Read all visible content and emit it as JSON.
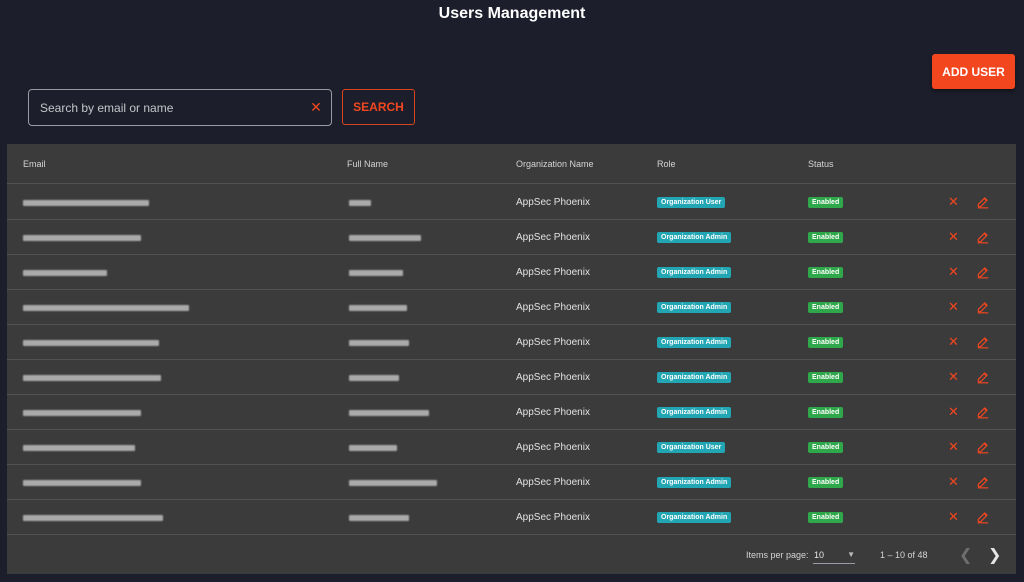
{
  "page": {
    "title": "Users Management"
  },
  "actions": {
    "add_user_label": "ADD USER"
  },
  "search": {
    "placeholder": "Search by email or name",
    "value": "",
    "button_label": "SEARCH",
    "clear_glyph": "✕"
  },
  "table": {
    "columns": [
      "Email",
      "Full Name",
      "Organization Name",
      "Role",
      "Status"
    ],
    "rows": [
      {
        "organization": "AppSec Phoenix",
        "role": "Organization User",
        "status": "Enabled"
      },
      {
        "organization": "AppSec Phoenix",
        "role": "Organization Admin",
        "status": "Enabled"
      },
      {
        "organization": "AppSec Phoenix",
        "role": "Organization Admin",
        "status": "Enabled"
      },
      {
        "organization": "AppSec Phoenix",
        "role": "Organization Admin",
        "status": "Enabled"
      },
      {
        "organization": "AppSec Phoenix",
        "role": "Organization Admin",
        "status": "Enabled"
      },
      {
        "organization": "AppSec Phoenix",
        "role": "Organization Admin",
        "status": "Enabled"
      },
      {
        "organization": "AppSec Phoenix",
        "role": "Organization Admin",
        "status": "Enabled"
      },
      {
        "organization": "AppSec Phoenix",
        "role": "Organization User",
        "status": "Enabled"
      },
      {
        "organization": "AppSec Phoenix",
        "role": "Organization Admin",
        "status": "Enabled"
      },
      {
        "organization": "AppSec Phoenix",
        "role": "Organization Admin",
        "status": "Enabled"
      }
    ]
  },
  "pagination": {
    "items_per_page_label": "Items per page:",
    "items_per_page": "10",
    "range": "1 – 10 of 48"
  },
  "icons": {
    "delete": "close-icon",
    "edit": "pencil-icon",
    "prev": "chevron-left-icon",
    "next": "chevron-right-icon"
  },
  "colors": {
    "accent": "#f2461f",
    "role_badge": "#22a6b3",
    "status_badge": "#2ea84a",
    "background": "#1c1f2b",
    "card": "#3b3b3b"
  }
}
